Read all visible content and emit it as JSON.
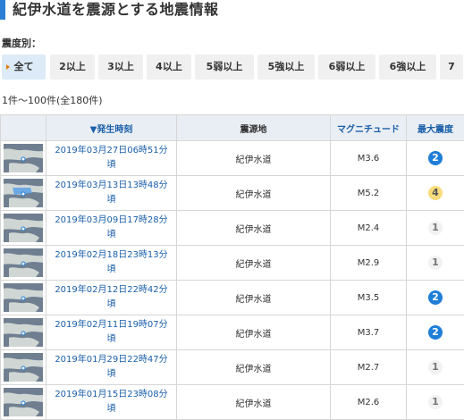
{
  "page": {
    "title": "紀伊水道を震源とする地震情報",
    "intensity_label": "震度別：",
    "count_text": "1件～100件(全180件)"
  },
  "colors": {
    "accent": "#2a7fd4",
    "link": "#1a5fa8",
    "intensity_1": "#f2f2f2",
    "intensity_2": "#1f7ed6",
    "intensity_4": "#f8dc7c"
  },
  "tabs": [
    {
      "label": "全て",
      "active": true
    },
    {
      "label": "2以上"
    },
    {
      "label": "3以上"
    },
    {
      "label": "4以上"
    },
    {
      "label": "5弱以上"
    },
    {
      "label": "5強以上"
    },
    {
      "label": "6弱以上"
    },
    {
      "label": "6強以上"
    },
    {
      "label": "7"
    }
  ],
  "table": {
    "headers": {
      "time": "▼発生時刻",
      "place": "震源地",
      "magnitude": "マグニチュード",
      "max_intensity": "最大震度"
    },
    "rows": [
      {
        "time": "2019年03月27日06時51分頃",
        "place": "紀伊水道",
        "magnitude": "M3.6",
        "intensity": "2",
        "map_icon": "epicenter-map-icon"
      },
      {
        "time": "2019年03月13日13時48分頃",
        "place": "紀伊水道",
        "magnitude": "M5.2",
        "intensity": "4",
        "map_icon": "epicenter-map-icon"
      },
      {
        "time": "2019年03月09日17時28分頃",
        "place": "紀伊水道",
        "magnitude": "M2.4",
        "intensity": "1",
        "map_icon": "epicenter-map-icon"
      },
      {
        "time": "2019年02月18日23時13分頃",
        "place": "紀伊水道",
        "magnitude": "M2.9",
        "intensity": "1",
        "map_icon": "epicenter-map-icon"
      },
      {
        "time": "2019年02月12日22時42分頃",
        "place": "紀伊水道",
        "magnitude": "M3.5",
        "intensity": "2",
        "map_icon": "epicenter-map-icon"
      },
      {
        "time": "2019年02月11日19時07分頃",
        "place": "紀伊水道",
        "magnitude": "M3.7",
        "intensity": "2",
        "map_icon": "epicenter-map-icon"
      },
      {
        "time": "2019年01月29日22時47分頃",
        "place": "紀伊水道",
        "magnitude": "M2.7",
        "intensity": "1",
        "map_icon": "epicenter-map-icon"
      },
      {
        "time": "2019年01月15日23時08分頃",
        "place": "紀伊水道",
        "magnitude": "M2.6",
        "intensity": "1",
        "map_icon": "epicenter-map-icon"
      }
    ]
  }
}
